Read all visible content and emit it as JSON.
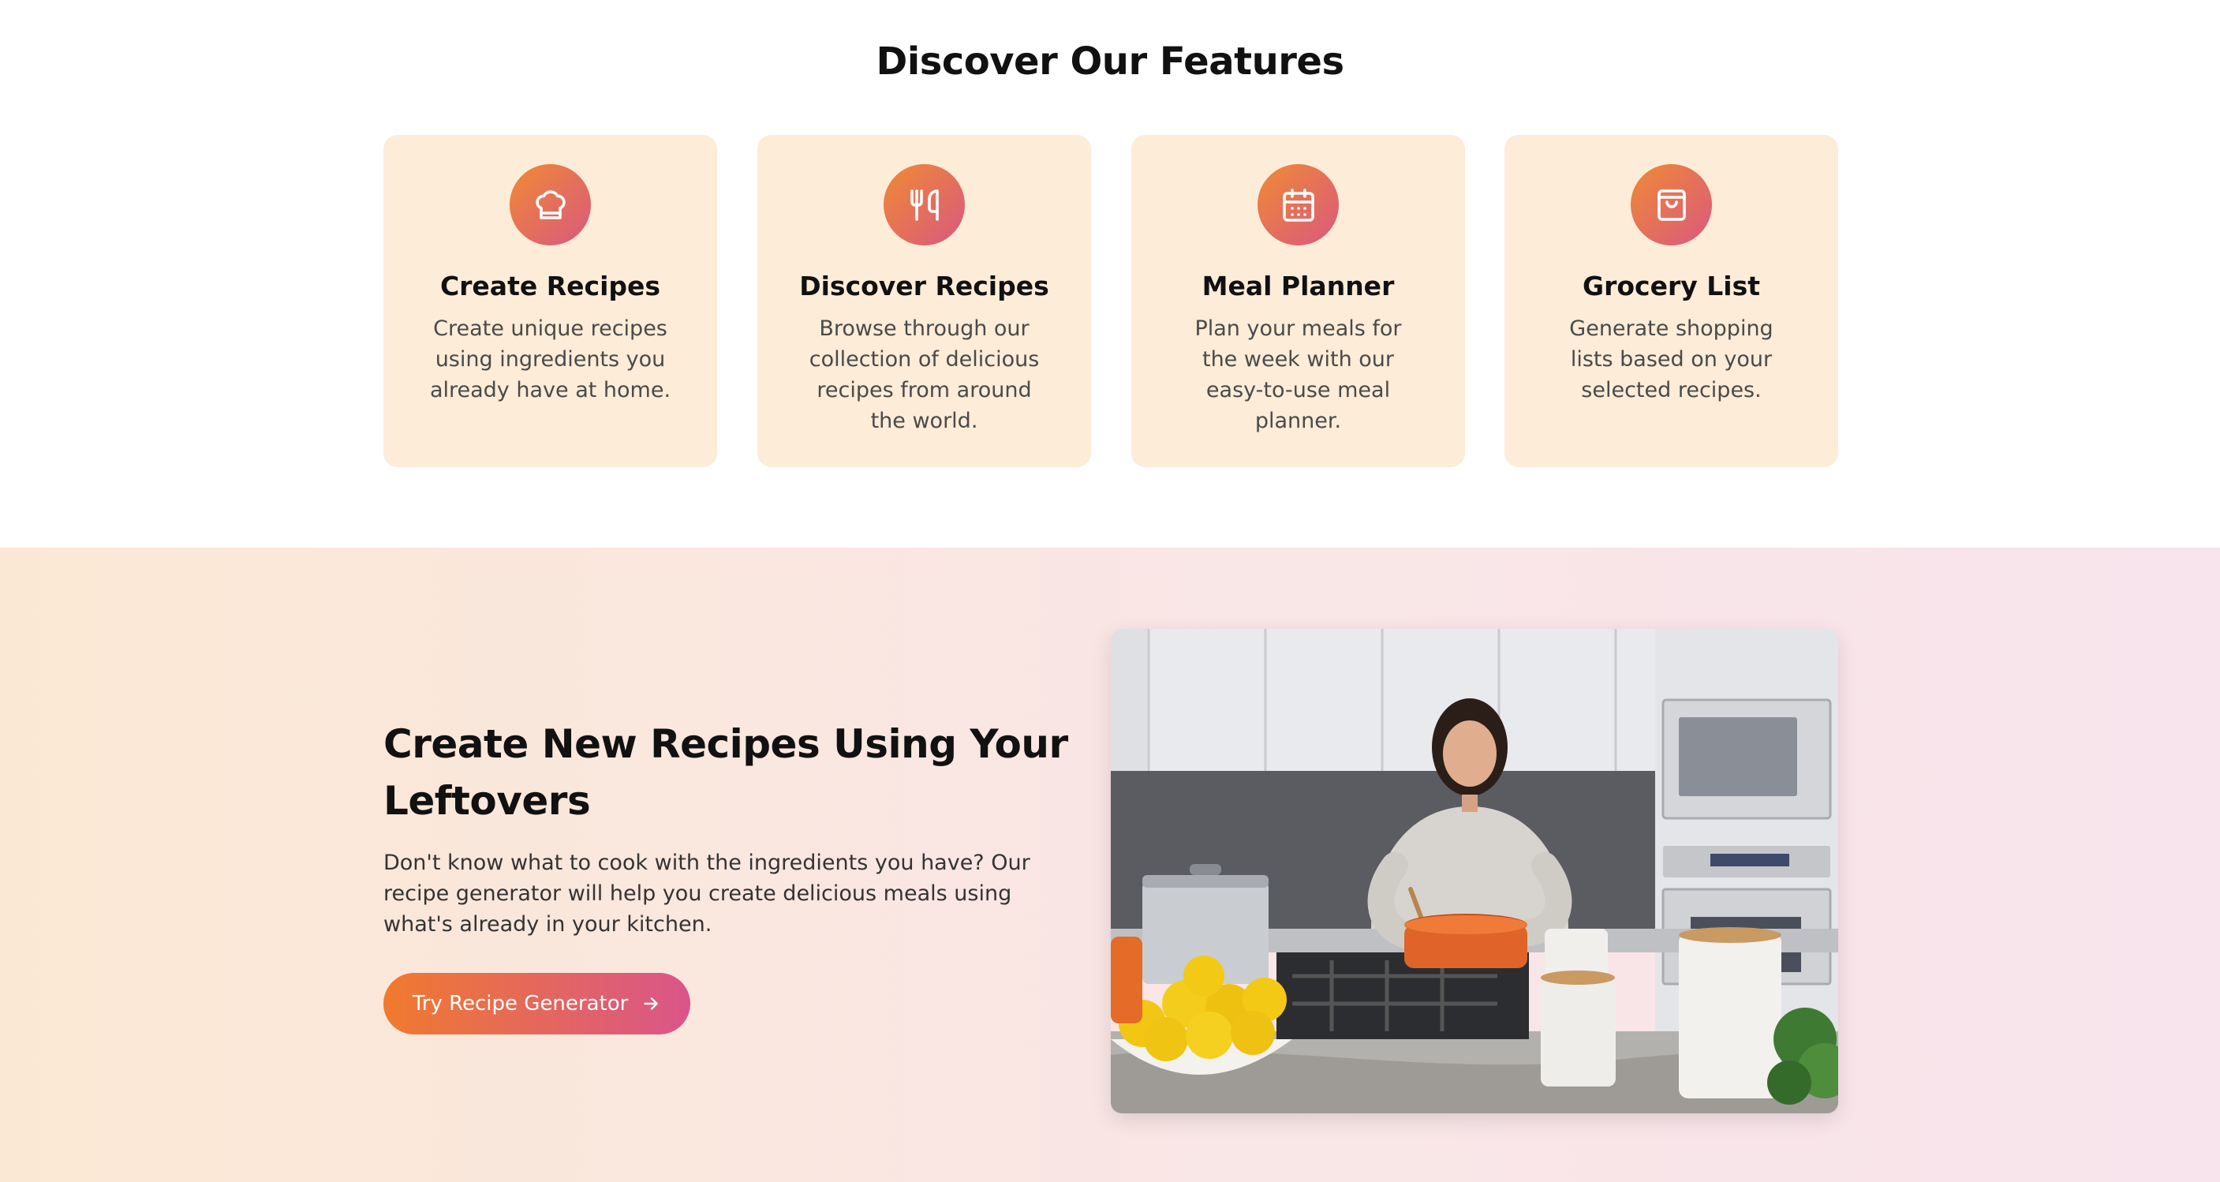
{
  "features": {
    "title": "Discover Our Features",
    "cards": [
      {
        "icon": "chef-hat-icon",
        "title": "Create Recipes",
        "desc": "Create unique recipes using ingredients you already have at home."
      },
      {
        "icon": "utensils-icon",
        "title": "Discover Recipes",
        "desc": "Browse through our collection of delicious recipes from around the world."
      },
      {
        "icon": "calendar-icon",
        "title": "Meal Planner",
        "desc": "Plan your meals for the week with our easy-to-use meal planner."
      },
      {
        "icon": "shopping-bag-icon",
        "title": "Grocery List",
        "desc": "Generate shopping lists based on your selected recipes."
      }
    ]
  },
  "hero": {
    "title": "Create New Recipes Using Your Leftovers",
    "desc": "Don't know what to cook with the ingredients you have? Our recipe generator will help you create delicious meals using what's already in your kitchen.",
    "cta_label": "Try Recipe Generator",
    "cta_icon": "arrow-right-icon",
    "image": "woman-cooking-in-kitchen-photo"
  },
  "colors": {
    "card_bg": "#fcecd8",
    "accent_start": "#f07a2e",
    "accent_end": "#d9558a"
  }
}
